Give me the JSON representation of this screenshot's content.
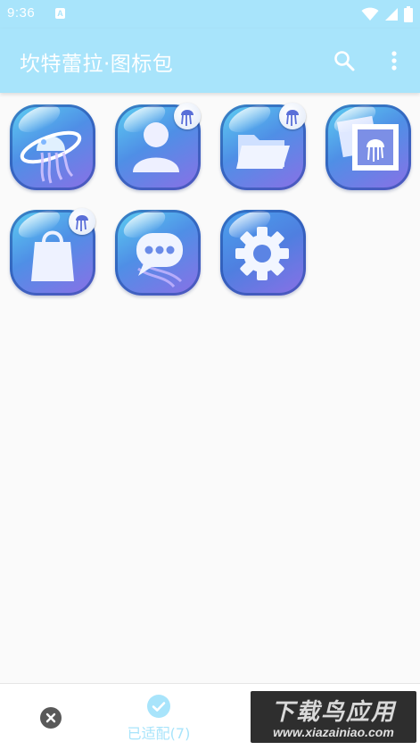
{
  "status_bar": {
    "time": "9:36",
    "notification_icon": "a-icon",
    "indicators": [
      "wifi-icon",
      "cellular-signal-icon",
      "battery-icon"
    ]
  },
  "app_bar": {
    "title": "坎特蕾拉·图标包",
    "actions": [
      "search-icon",
      "more-vert-icon"
    ]
  },
  "icons": [
    {
      "name": "browser-icon",
      "glyph": "jellyfish-globe",
      "badge": false
    },
    {
      "name": "contacts-icon",
      "glyph": "person",
      "badge": true
    },
    {
      "name": "file-manager-icon",
      "glyph": "folder",
      "badge": true
    },
    {
      "name": "gallery-icon",
      "glyph": "jellyfish-picture",
      "badge": false
    },
    {
      "name": "app-store-icon",
      "glyph": "shopping-bag",
      "badge": true
    },
    {
      "name": "messages-icon",
      "glyph": "chat-bubble",
      "badge": false
    },
    {
      "name": "settings-icon",
      "glyph": "gear",
      "badge": false
    }
  ],
  "bottom_bar": {
    "dismiss_icon": "close-circle-icon",
    "adapted_label": "已适配(7)",
    "adapted_icon": "check-circle-icon",
    "accent_color": "#a8e4fb"
  },
  "watermark": {
    "title": "下载鸟应用",
    "url": "www.xiazainiao.com"
  },
  "colors": {
    "primary": "#a8e4fb",
    "background": "#fafafa",
    "on_primary": "#ffffff"
  }
}
